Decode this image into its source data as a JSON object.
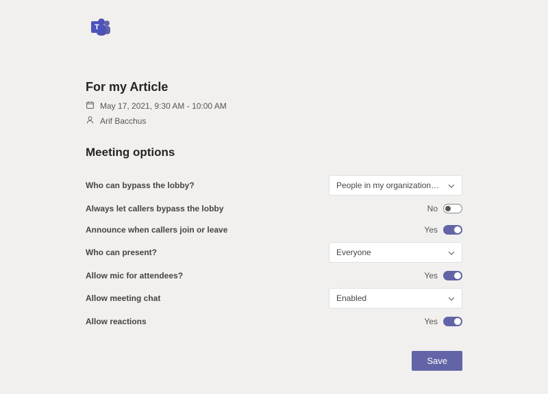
{
  "meeting": {
    "title": "For my Article",
    "datetime": "May 17, 2021, 9:30 AM - 10:00 AM",
    "organizer": "Arif Bacchus"
  },
  "section_title": "Meeting options",
  "options": {
    "bypass_lobby": {
      "label": "Who can bypass the lobby?",
      "value": "People in my organization and gu..."
    },
    "callers_bypass": {
      "label": "Always let callers bypass the lobby",
      "state_text": "No",
      "on": false
    },
    "announce": {
      "label": "Announce when callers join or leave",
      "state_text": "Yes",
      "on": true
    },
    "present": {
      "label": "Who can present?",
      "value": "Everyone"
    },
    "mic": {
      "label": "Allow mic for attendees?",
      "state_text": "Yes",
      "on": true
    },
    "chat": {
      "label": "Allow meeting chat",
      "value": "Enabled"
    },
    "reactions": {
      "label": "Allow reactions",
      "state_text": "Yes",
      "on": true
    }
  },
  "save_label": "Save"
}
